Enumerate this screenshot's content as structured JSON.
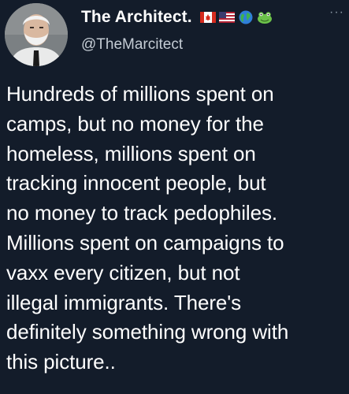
{
  "author": {
    "display_name": "The Architect.",
    "handle": "@TheMarcitect",
    "badges": [
      "canada-flag-icon",
      "usa-flag-icon",
      "globe-icon",
      "frog-icon"
    ]
  },
  "more_menu_icon": "ellipsis-icon",
  "tweet_lines": [
    "Hundreds of millions spent on",
    "camps, but no money for the",
    "homeless, millions spent on",
    "tracking innocent people, but",
    "no money to track pedophiles.",
    "Millions spent on campaigns to",
    "vaxx every citizen, but not",
    "illegal immigrants. There's",
    "definitely something wrong with",
    "this picture.."
  ],
  "colors": {
    "background": "#131c2a",
    "text": "#ffffff",
    "handle": "#c4ccd4"
  }
}
